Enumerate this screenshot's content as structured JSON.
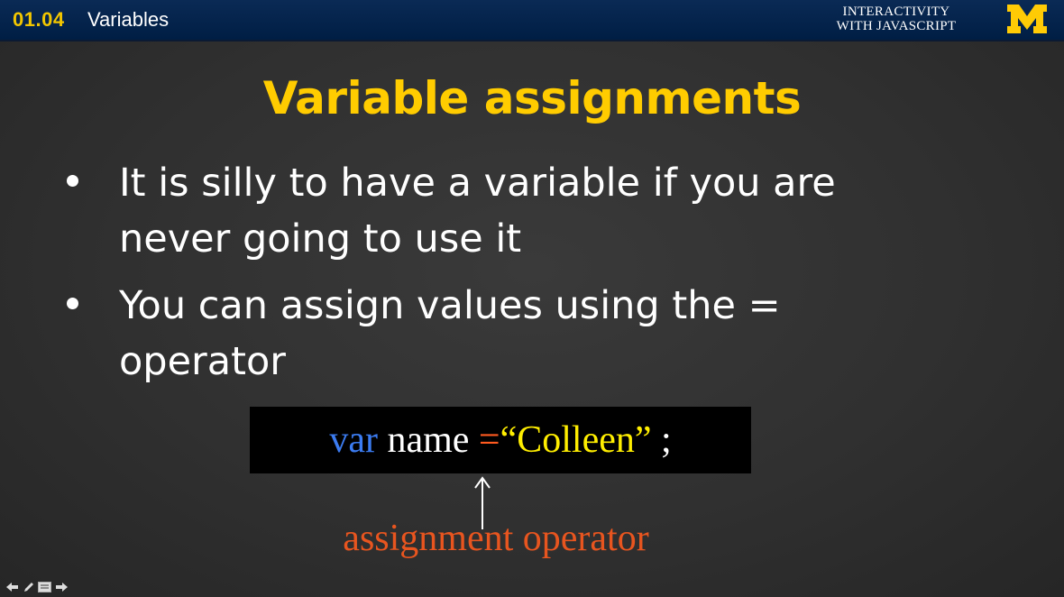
{
  "header": {
    "lesson_number": "01.04",
    "lesson_title": "Variables",
    "course_title_line1": "INTERACTIVITY",
    "course_title_line2": "WITH JAVASCRIPT",
    "logo_icon": "university-of-michigan-block-m-logo",
    "colors": {
      "bar": "#00274c",
      "accent": "#ffcb05"
    }
  },
  "slide": {
    "heading": "Variable assignments",
    "bullets": [
      {
        "line1": "It is silly to have a variable if you are",
        "line2": "never going to use it"
      },
      {
        "line1": "You can assign values using the =",
        "line2": "operator"
      }
    ],
    "code": {
      "keyword": "var",
      "identifier": "name",
      "operator": "=",
      "value": "“Colleen”",
      "terminator": ";"
    },
    "annotation": "assignment operator",
    "colors": {
      "heading": "#ffcc00",
      "keyword": "#3b7bf0",
      "operator": "#ff5a1f",
      "string": "#ffee00",
      "annotation": "#e8551f"
    }
  },
  "nav_controls": [
    {
      "icon": "arrow-left-icon"
    },
    {
      "icon": "pen-icon"
    },
    {
      "icon": "menu-icon"
    },
    {
      "icon": "arrow-right-icon"
    }
  ]
}
